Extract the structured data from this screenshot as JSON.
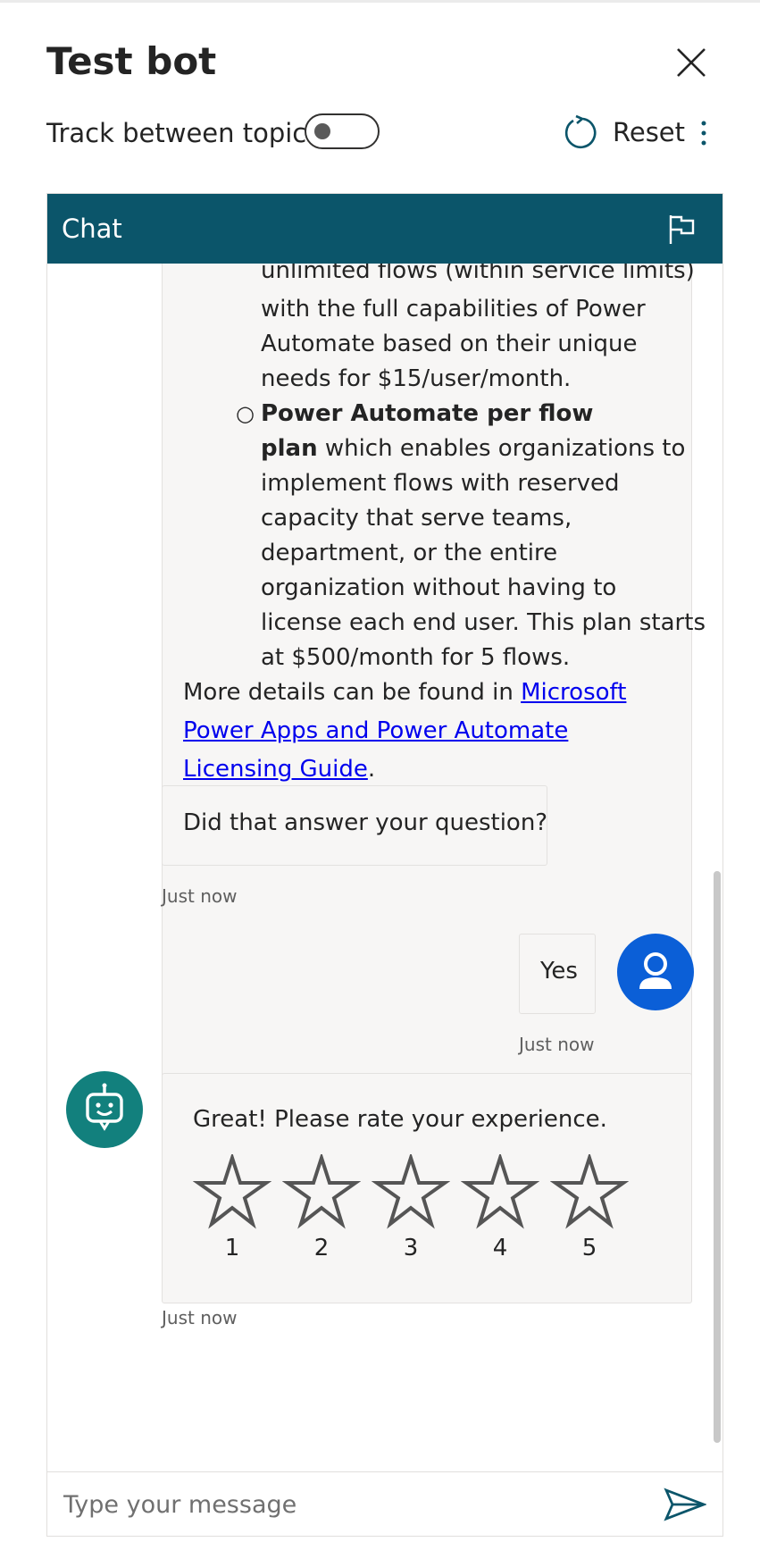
{
  "panel": {
    "title": "Test bot",
    "track_label": "Track between topics",
    "track_enabled": false,
    "reset_label": "Reset"
  },
  "chat": {
    "header_title": "Chat",
    "messages": {
      "licensing_lines": [
        "unlimited flows (within service limits)",
        "with the full capabilities of Power",
        "Automate based on their unique",
        "needs for $15/user/month."
      ],
      "per_flow_bold_1": "Power Automate per flow",
      "per_flow_bold_2": "plan",
      "per_flow_rest_1": " which enables organizations to",
      "per_flow_lines": [
        "implement flows with reserved",
        "capacity that serve teams,",
        "department, or the entire",
        "organization without having to",
        "license each end user. This plan starts",
        "at $500/month for 5 flows."
      ],
      "more_details_prefix": "More details can be found in ",
      "more_details_link": "Microsoft Power Apps and Power Automate Licensing Guide",
      "more_details_suffix": ".",
      "followup_question": "Did that answer your question?",
      "followup_time": "Just now",
      "user_reply": "Yes",
      "user_reply_time": "Just now",
      "rating_prompt": "Great! Please rate your experience.",
      "rating_time": "Just now"
    },
    "rating_options": [
      "1",
      "2",
      "3",
      "4",
      "5"
    ],
    "input_placeholder": "Type your message"
  },
  "colors": {
    "chat_header": "#0b556a",
    "user_avatar": "#0b5fd7",
    "bot_avatar": "#12807d",
    "send_icon": "#0b556a"
  },
  "icons": {
    "close": "close-icon",
    "reset": "refresh-icon",
    "more": "more-vertical-icon",
    "flag": "flag-icon",
    "user": "person-icon",
    "bot": "bot-icon",
    "star": "star-outline-icon",
    "send": "send-icon"
  }
}
